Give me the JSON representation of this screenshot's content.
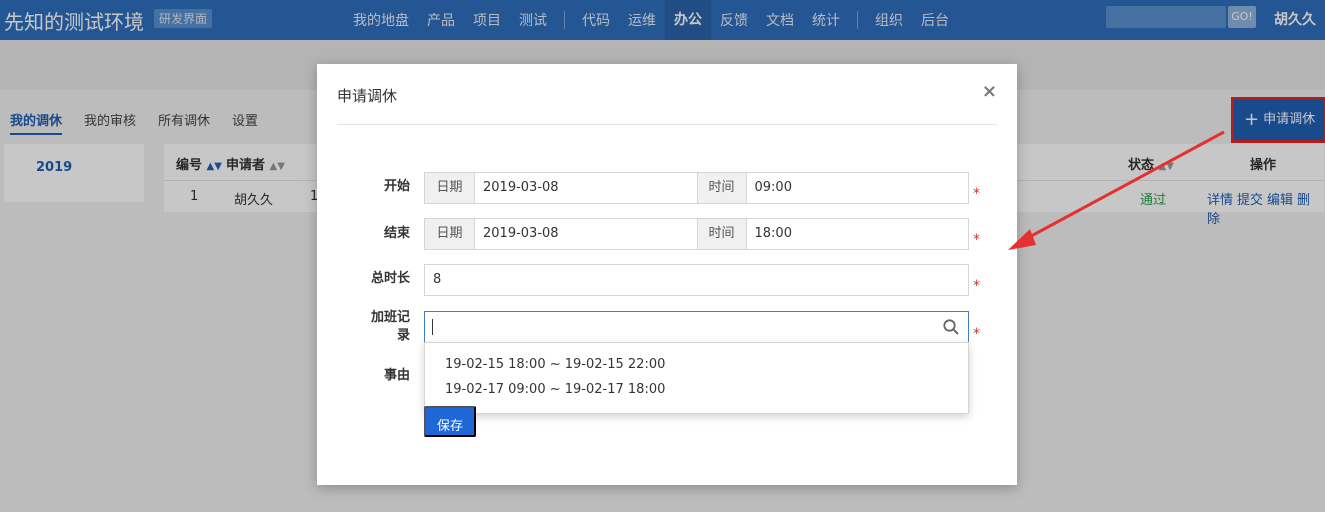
{
  "header": {
    "brand": "先知的测试环境",
    "badge": "研发界面",
    "nav": [
      "我的地盘",
      "产品",
      "项目",
      "测试",
      "代码",
      "运维",
      "办公",
      "反馈",
      "文档",
      "统计",
      "组织",
      "后台"
    ],
    "active_nav": "办公",
    "search_button": "GO!",
    "user": "胡久久"
  },
  "leave_tabs": [
    {
      "label": "我的调休",
      "active": true
    },
    {
      "label": "我的审核",
      "active": false
    },
    {
      "label": "所有调休",
      "active": false
    },
    {
      "label": "设置",
      "active": false
    }
  ],
  "apply_button": "申请调休",
  "year": "2019",
  "table": {
    "headers": {
      "id": "编号",
      "applicant": "申请者",
      "status": "状态",
      "actions": "操作"
    },
    "row": {
      "id": "1",
      "applicant": "胡久久",
      "partial": "1",
      "status": "通过",
      "actions": [
        "详情",
        "提交",
        "编辑",
        "删除"
      ]
    }
  },
  "modal": {
    "title": "申请调休",
    "close": "×",
    "start": {
      "label": "开始",
      "date_label": "日期",
      "date": "2019-03-08",
      "time_label": "时间",
      "time": "09:00"
    },
    "end": {
      "label": "结束",
      "date_label": "日期",
      "date": "2019-03-08",
      "time_label": "时间",
      "time": "18:00"
    },
    "duration": {
      "label": "总时长",
      "value": "8"
    },
    "overtime": {
      "label_line1": "加班记",
      "label_line2": "录",
      "value": ""
    },
    "reason": {
      "label": "事由"
    },
    "required_mark": "*",
    "options": [
      "19-02-15 18:00 ~ 19-02-15 22:00",
      "19-02-17 09:00 ~ 19-02-17 18:00"
    ],
    "save": "保存"
  },
  "colors": {
    "header": "#2f6fbd",
    "accent": "#1f5fb4",
    "required": "#e02828",
    "ok": "#2e9d49"
  },
  "icons": [
    "search-icon",
    "sort-icon",
    "plus-icon",
    "close-icon"
  ]
}
